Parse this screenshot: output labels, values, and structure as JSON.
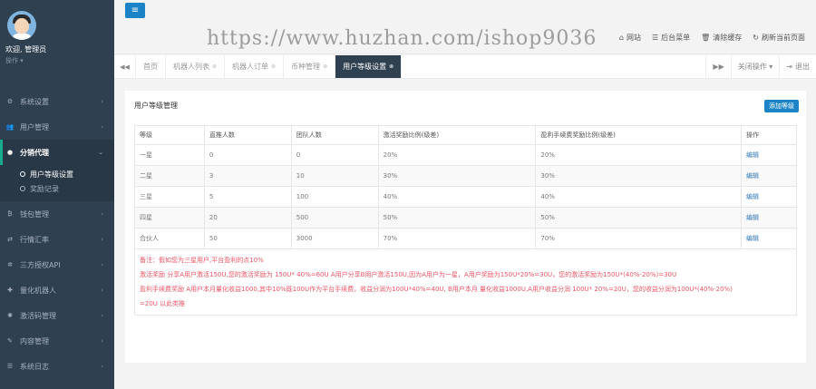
{
  "profile": {
    "welcome": "欢迎, 管理员",
    "role": "操作 ▾"
  },
  "sidebar": {
    "items": [
      {
        "label": "系统设置",
        "icon": "gears-icon"
      },
      {
        "label": "用户管理",
        "icon": "users-icon"
      },
      {
        "label": "分销代理",
        "icon": "user-icon"
      }
    ],
    "submenu": [
      {
        "label": "用户等级设置"
      },
      {
        "label": "奖励记录"
      }
    ],
    "items_after": [
      {
        "label": "钱包管理",
        "icon": "bitcoin-icon"
      },
      {
        "label": "行情汇率",
        "icon": "exchange-icon"
      },
      {
        "label": "三方授权API",
        "icon": "gear-icon"
      },
      {
        "label": "量化机器人",
        "icon": "robot-icon"
      },
      {
        "label": "激活码管理",
        "icon": "cog-icon"
      },
      {
        "label": "内容管理",
        "icon": "edit-icon"
      },
      {
        "label": "系统日志",
        "icon": "list-icon"
      }
    ]
  },
  "header": {
    "menu_button": "≡",
    "watermark": "https://www.huzhan.com/ishop9036",
    "actions": [
      {
        "label": "网站",
        "icon": "home-icon"
      },
      {
        "label": "后台菜单",
        "icon": "list-icon"
      },
      {
        "label": "清除缓存",
        "icon": "trash-icon"
      },
      {
        "label": "刷新当前页面",
        "icon": "refresh-icon"
      }
    ]
  },
  "tabs": {
    "items": [
      {
        "label": "首页",
        "closable": false
      },
      {
        "label": "机器人列表",
        "closable": true
      },
      {
        "label": "机器人订单",
        "closable": true
      },
      {
        "label": "币种管理",
        "closable": true
      },
      {
        "label": "用户等级设置",
        "closable": true,
        "active": true
      }
    ],
    "close_ops": "关闭操作 ▾",
    "logout": "退出"
  },
  "panel": {
    "title": "用户等级管理",
    "add_button": "添加等级",
    "columns": [
      "等级",
      "直推人数",
      "团队人数",
      "激活奖励比例(级差)",
      "盈利手续费奖励比例(级差)",
      "操作"
    ],
    "rows": [
      [
        "一星",
        "0",
        "0",
        "20%",
        "20%",
        "编辑"
      ],
      [
        "二星",
        "3",
        "10",
        "30%",
        "30%",
        "编辑"
      ],
      [
        "三星",
        "5",
        "100",
        "40%",
        "40%",
        "编辑"
      ],
      [
        "四星",
        "20",
        "500",
        "50%",
        "50%",
        "编辑"
      ],
      [
        "合伙人",
        "50",
        "3000",
        "70%",
        "70%",
        "编辑"
      ]
    ],
    "notes": [
      "备注：假如您为三星用户,平台盈利的点10%",
      "激活奖励 分享A用户激活150U,您的激活奖励为 150U* 40%=60U A用户分享B用户激活150U,因为A用户为一星，A用户奖励为150U*20%=30U，您的激活奖励为150U*(40%-20%)=30U",
      "盈利手续费奖励 A用户本月量化收益1000,其中10%既100U作为平台手续费，收益分润为100U*40%=40U, B用户本月 量化收益1000U,A用户收益分润 100U* 20%=20U，您的收益分润为100U*(40%-20%)",
      "=20U 以此类推"
    ]
  },
  "colors": {
    "sidebar_bg": "#2f4050",
    "primary": "#1c84c6",
    "note_red": "#ed5565",
    "active_accent": "#19aa8d"
  }
}
